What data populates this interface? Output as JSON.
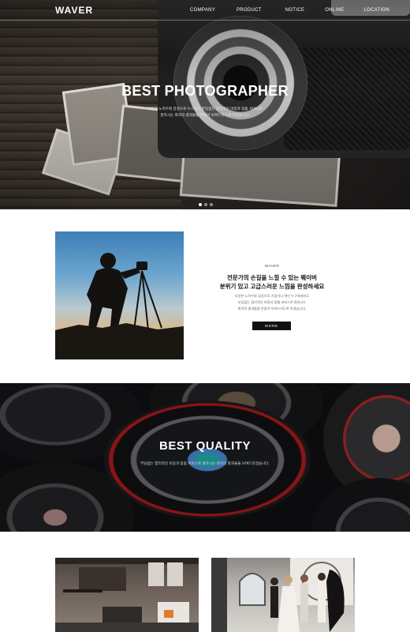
{
  "brand": {
    "logo": "WAVER"
  },
  "nav": {
    "items": [
      "COMPANY",
      "PRODUCT",
      "NOTICE",
      "ONLINE",
      "LOCATION"
    ]
  },
  "hero": {
    "title": "BEST PHOTOGRAPHER",
    "description_line1": "다양한 노하우와 감성으로 누구라도 부담없는 합리적인 비용과 맞춤 서비스로",
    "description_line2": "원하시는 최적의 결과물을 만들어 보여드리도록 하겠습니다.",
    "slides": 3,
    "active_slide": 1
  },
  "about": {
    "kicker": "WAVER",
    "heading_line1": "전문가의 손길을 느낄 수 있는 웨이버",
    "heading_line2": "분위기 있고 고급스러운 느낌을 완성하세요",
    "text_line1": "다양한 노하우와 감성으로 기업이나 개인 누구에게라도",
    "text_line2": "부담없는 합리적인 비용과 맞춤 서비스로 원하시는",
    "text_line3": "최적의 결과물을 만들어 보여드리도록 하겠습니다.",
    "more_label": "MORE"
  },
  "quality": {
    "title": "BEST QUALITY",
    "description": "부담없는 합리적인 비용과 맞춤 서비스로 원하시는 최적의 결과물을 보여드리겠습니다."
  },
  "colors": {
    "dark": "#111111",
    "white": "#ffffff"
  }
}
